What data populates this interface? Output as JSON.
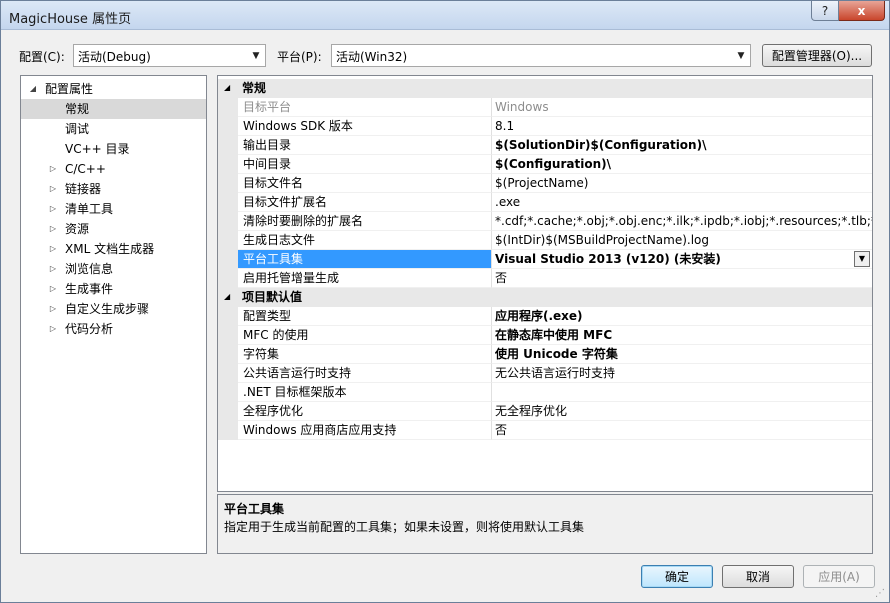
{
  "window": {
    "title": "MagicHouse 属性页",
    "help_label": "?",
    "close_label": "x"
  },
  "config": {
    "config_label": "配置(C):",
    "config_value": "活动(Debug)",
    "platform_label": "平台(P):",
    "platform_value": "活动(Win32)",
    "manager_label": "配置管理器(O)..."
  },
  "tree": {
    "root": "配置属性",
    "items": [
      {
        "label": "常规",
        "expandable": false,
        "selected": true
      },
      {
        "label": "调试",
        "expandable": false,
        "selected": false
      },
      {
        "label": "VC++ 目录",
        "expandable": false,
        "selected": false
      },
      {
        "label": "C/C++",
        "expandable": true,
        "selected": false
      },
      {
        "label": "链接器",
        "expandable": true,
        "selected": false
      },
      {
        "label": "清单工具",
        "expandable": true,
        "selected": false
      },
      {
        "label": "资源",
        "expandable": true,
        "selected": false
      },
      {
        "label": "XML 文档生成器",
        "expandable": true,
        "selected": false
      },
      {
        "label": "浏览信息",
        "expandable": true,
        "selected": false
      },
      {
        "label": "生成事件",
        "expandable": true,
        "selected": false
      },
      {
        "label": "自定义生成步骤",
        "expandable": true,
        "selected": false
      },
      {
        "label": "代码分析",
        "expandable": true,
        "selected": false
      }
    ]
  },
  "grid": {
    "categories": [
      {
        "label": "常规",
        "rows": [
          {
            "name": "目标平台",
            "value": "Windows",
            "style": "gray"
          },
          {
            "name": "Windows SDK 版本",
            "value": "8.1",
            "style": ""
          },
          {
            "name": "输出目录",
            "value": "$(SolutionDir)$(Configuration)\\",
            "style": "bold"
          },
          {
            "name": "中间目录",
            "value": "$(Configuration)\\",
            "style": "bold"
          },
          {
            "name": "目标文件名",
            "value": "$(ProjectName)",
            "style": ""
          },
          {
            "name": "目标文件扩展名",
            "value": ".exe",
            "style": ""
          },
          {
            "name": "清除时要删除的扩展名",
            "value": "*.cdf;*.cache;*.obj;*.obj.enc;*.ilk;*.ipdb;*.iobj;*.resources;*.tlb;*.tli;*.t",
            "style": ""
          },
          {
            "name": "生成日志文件",
            "value": "$(IntDir)$(MSBuildProjectName).log",
            "style": ""
          },
          {
            "name": "平台工具集",
            "value": "Visual Studio 2013 (v120) (未安装)",
            "style": "bold",
            "selected": true
          },
          {
            "name": "启用托管增量生成",
            "value": "否",
            "style": ""
          }
        ]
      },
      {
        "label": "项目默认值",
        "rows": [
          {
            "name": "配置类型",
            "value": "应用程序(.exe)",
            "style": "bold"
          },
          {
            "name": "MFC 的使用",
            "value": "在静态库中使用 MFC",
            "style": "bold"
          },
          {
            "name": "字符集",
            "value": "使用 Unicode 字符集",
            "style": "bold"
          },
          {
            "name": "公共语言运行时支持",
            "value": "无公共语言运行时支持",
            "style": ""
          },
          {
            "name": ".NET 目标框架版本",
            "value": "",
            "style": ""
          },
          {
            "name": "全程序优化",
            "value": "无全程序优化",
            "style": ""
          },
          {
            "name": "Windows 应用商店应用支持",
            "value": "否",
            "style": ""
          }
        ]
      }
    ]
  },
  "description": {
    "title": "平台工具集",
    "text": "指定用于生成当前配置的工具集；如果未设置，则将使用默认工具集"
  },
  "buttons": {
    "ok": "确定",
    "cancel": "取消",
    "apply": "应用(A)"
  }
}
